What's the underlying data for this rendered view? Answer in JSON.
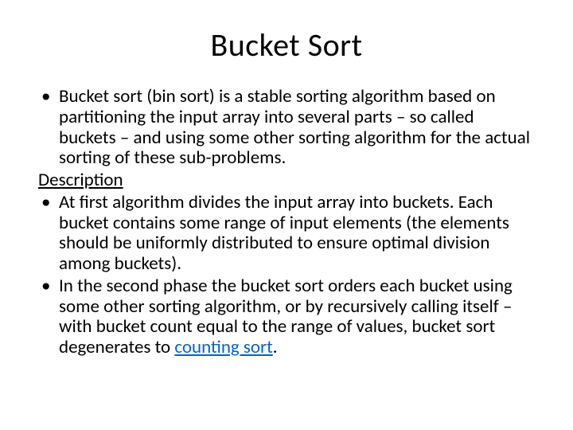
{
  "title": "Bucket Sort",
  "bullets": {
    "b1": "Bucket sort (bin sort) is a stable sorting algorithm based on partitioning the input array into several parts – so called buckets – and using some other sorting algorithm for the actual sorting of these sub-problems.",
    "desc_label": "Description",
    "b2": "At first algorithm divides the input array into buckets. Each bucket contains some range of input elements (the elements should be uniformly distributed to ensure optimal division among buckets).",
    "b3_pre": "In the second phase the bucket sort orders each bucket using some other sorting algorithm, or by recursively calling itself – with bucket count equal to the range of values, bucket sort degenerates to ",
    "b3_link": "counting sort",
    "b3_post": "."
  }
}
